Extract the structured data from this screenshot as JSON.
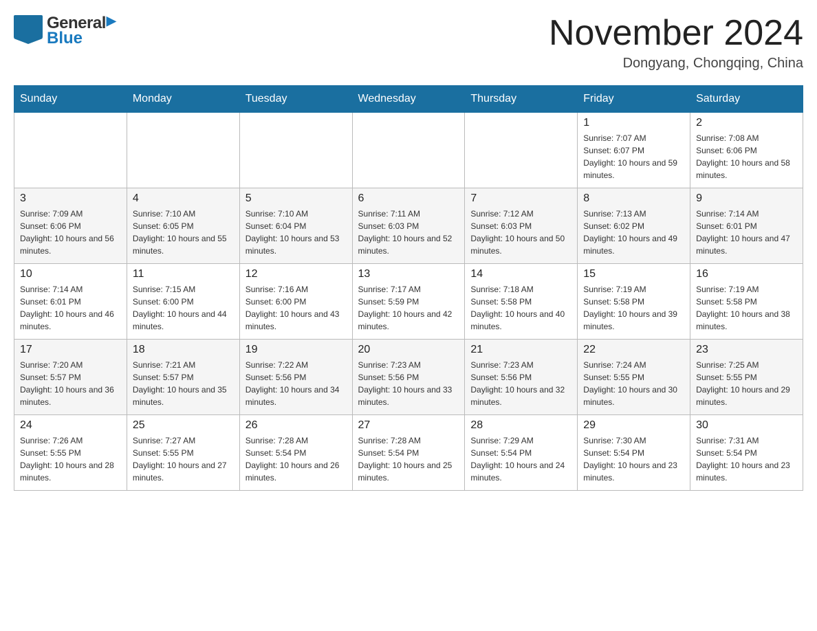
{
  "header": {
    "logo": {
      "general_text": "General",
      "blue_text": "Blue"
    },
    "title": "November 2024",
    "location": "Dongyang, Chongqing, China"
  },
  "weekdays": [
    "Sunday",
    "Monday",
    "Tuesday",
    "Wednesday",
    "Thursday",
    "Friday",
    "Saturday"
  ],
  "weeks": [
    {
      "days": [
        {
          "num": "",
          "sunrise": "",
          "sunset": "",
          "daylight": ""
        },
        {
          "num": "",
          "sunrise": "",
          "sunset": "",
          "daylight": ""
        },
        {
          "num": "",
          "sunrise": "",
          "sunset": "",
          "daylight": ""
        },
        {
          "num": "",
          "sunrise": "",
          "sunset": "",
          "daylight": ""
        },
        {
          "num": "",
          "sunrise": "",
          "sunset": "",
          "daylight": ""
        },
        {
          "num": "1",
          "sunrise": "Sunrise: 7:07 AM",
          "sunset": "Sunset: 6:07 PM",
          "daylight": "Daylight: 10 hours and 59 minutes."
        },
        {
          "num": "2",
          "sunrise": "Sunrise: 7:08 AM",
          "sunset": "Sunset: 6:06 PM",
          "daylight": "Daylight: 10 hours and 58 minutes."
        }
      ]
    },
    {
      "days": [
        {
          "num": "3",
          "sunrise": "Sunrise: 7:09 AM",
          "sunset": "Sunset: 6:06 PM",
          "daylight": "Daylight: 10 hours and 56 minutes."
        },
        {
          "num": "4",
          "sunrise": "Sunrise: 7:10 AM",
          "sunset": "Sunset: 6:05 PM",
          "daylight": "Daylight: 10 hours and 55 minutes."
        },
        {
          "num": "5",
          "sunrise": "Sunrise: 7:10 AM",
          "sunset": "Sunset: 6:04 PM",
          "daylight": "Daylight: 10 hours and 53 minutes."
        },
        {
          "num": "6",
          "sunrise": "Sunrise: 7:11 AM",
          "sunset": "Sunset: 6:03 PM",
          "daylight": "Daylight: 10 hours and 52 minutes."
        },
        {
          "num": "7",
          "sunrise": "Sunrise: 7:12 AM",
          "sunset": "Sunset: 6:03 PM",
          "daylight": "Daylight: 10 hours and 50 minutes."
        },
        {
          "num": "8",
          "sunrise": "Sunrise: 7:13 AM",
          "sunset": "Sunset: 6:02 PM",
          "daylight": "Daylight: 10 hours and 49 minutes."
        },
        {
          "num": "9",
          "sunrise": "Sunrise: 7:14 AM",
          "sunset": "Sunset: 6:01 PM",
          "daylight": "Daylight: 10 hours and 47 minutes."
        }
      ]
    },
    {
      "days": [
        {
          "num": "10",
          "sunrise": "Sunrise: 7:14 AM",
          "sunset": "Sunset: 6:01 PM",
          "daylight": "Daylight: 10 hours and 46 minutes."
        },
        {
          "num": "11",
          "sunrise": "Sunrise: 7:15 AM",
          "sunset": "Sunset: 6:00 PM",
          "daylight": "Daylight: 10 hours and 44 minutes."
        },
        {
          "num": "12",
          "sunrise": "Sunrise: 7:16 AM",
          "sunset": "Sunset: 6:00 PM",
          "daylight": "Daylight: 10 hours and 43 minutes."
        },
        {
          "num": "13",
          "sunrise": "Sunrise: 7:17 AM",
          "sunset": "Sunset: 5:59 PM",
          "daylight": "Daylight: 10 hours and 42 minutes."
        },
        {
          "num": "14",
          "sunrise": "Sunrise: 7:18 AM",
          "sunset": "Sunset: 5:58 PM",
          "daylight": "Daylight: 10 hours and 40 minutes."
        },
        {
          "num": "15",
          "sunrise": "Sunrise: 7:19 AM",
          "sunset": "Sunset: 5:58 PM",
          "daylight": "Daylight: 10 hours and 39 minutes."
        },
        {
          "num": "16",
          "sunrise": "Sunrise: 7:19 AM",
          "sunset": "Sunset: 5:58 PM",
          "daylight": "Daylight: 10 hours and 38 minutes."
        }
      ]
    },
    {
      "days": [
        {
          "num": "17",
          "sunrise": "Sunrise: 7:20 AM",
          "sunset": "Sunset: 5:57 PM",
          "daylight": "Daylight: 10 hours and 36 minutes."
        },
        {
          "num": "18",
          "sunrise": "Sunrise: 7:21 AM",
          "sunset": "Sunset: 5:57 PM",
          "daylight": "Daylight: 10 hours and 35 minutes."
        },
        {
          "num": "19",
          "sunrise": "Sunrise: 7:22 AM",
          "sunset": "Sunset: 5:56 PM",
          "daylight": "Daylight: 10 hours and 34 minutes."
        },
        {
          "num": "20",
          "sunrise": "Sunrise: 7:23 AM",
          "sunset": "Sunset: 5:56 PM",
          "daylight": "Daylight: 10 hours and 33 minutes."
        },
        {
          "num": "21",
          "sunrise": "Sunrise: 7:23 AM",
          "sunset": "Sunset: 5:56 PM",
          "daylight": "Daylight: 10 hours and 32 minutes."
        },
        {
          "num": "22",
          "sunrise": "Sunrise: 7:24 AM",
          "sunset": "Sunset: 5:55 PM",
          "daylight": "Daylight: 10 hours and 30 minutes."
        },
        {
          "num": "23",
          "sunrise": "Sunrise: 7:25 AM",
          "sunset": "Sunset: 5:55 PM",
          "daylight": "Daylight: 10 hours and 29 minutes."
        }
      ]
    },
    {
      "days": [
        {
          "num": "24",
          "sunrise": "Sunrise: 7:26 AM",
          "sunset": "Sunset: 5:55 PM",
          "daylight": "Daylight: 10 hours and 28 minutes."
        },
        {
          "num": "25",
          "sunrise": "Sunrise: 7:27 AM",
          "sunset": "Sunset: 5:55 PM",
          "daylight": "Daylight: 10 hours and 27 minutes."
        },
        {
          "num": "26",
          "sunrise": "Sunrise: 7:28 AM",
          "sunset": "Sunset: 5:54 PM",
          "daylight": "Daylight: 10 hours and 26 minutes."
        },
        {
          "num": "27",
          "sunrise": "Sunrise: 7:28 AM",
          "sunset": "Sunset: 5:54 PM",
          "daylight": "Daylight: 10 hours and 25 minutes."
        },
        {
          "num": "28",
          "sunrise": "Sunrise: 7:29 AM",
          "sunset": "Sunset: 5:54 PM",
          "daylight": "Daylight: 10 hours and 24 minutes."
        },
        {
          "num": "29",
          "sunrise": "Sunrise: 7:30 AM",
          "sunset": "Sunset: 5:54 PM",
          "daylight": "Daylight: 10 hours and 23 minutes."
        },
        {
          "num": "30",
          "sunrise": "Sunrise: 7:31 AM",
          "sunset": "Sunset: 5:54 PM",
          "daylight": "Daylight: 10 hours and 23 minutes."
        }
      ]
    }
  ]
}
